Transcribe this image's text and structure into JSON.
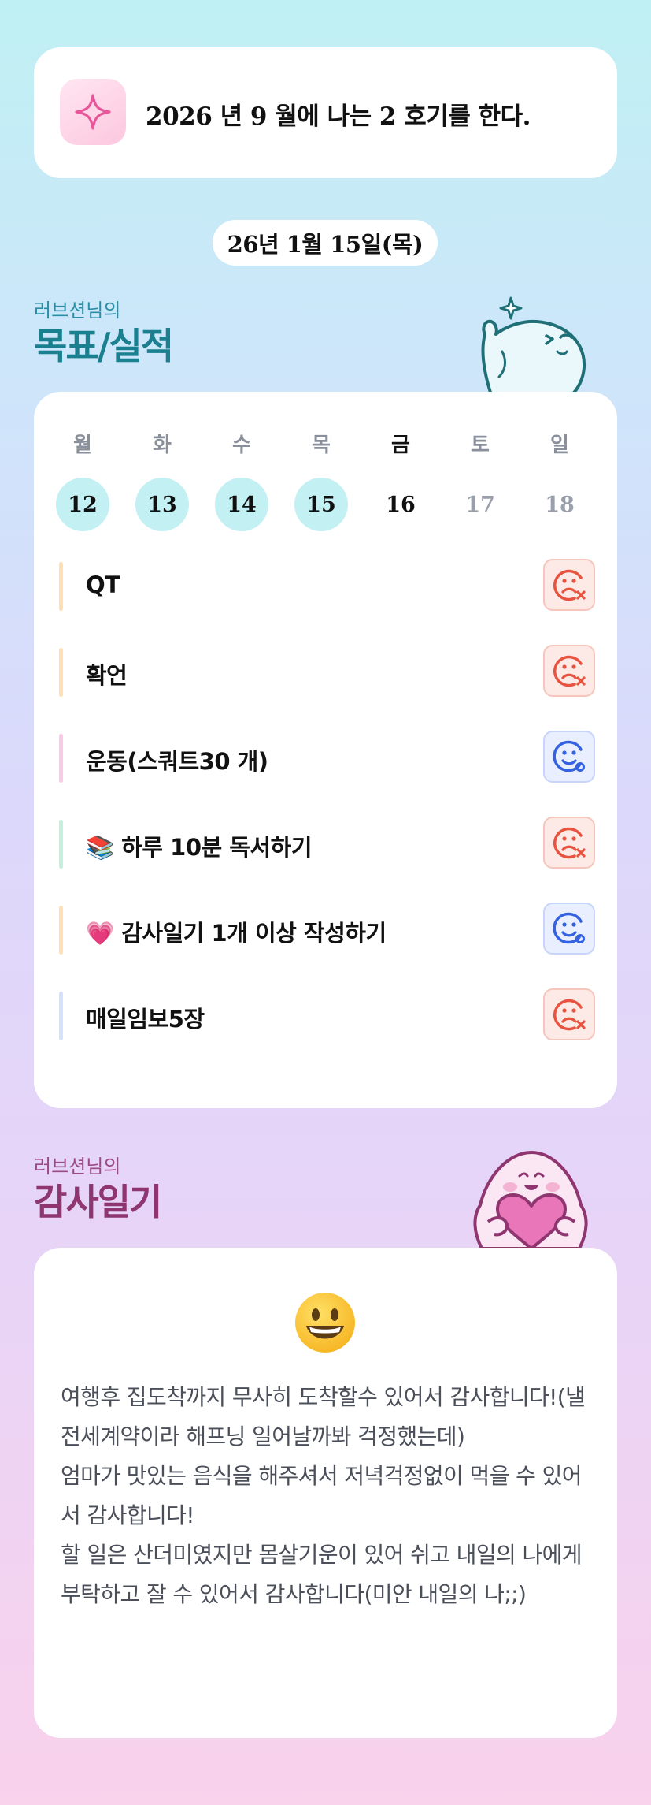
{
  "header": {
    "goal_statement": "2026 년 9 월에 나는 2 호기를 한다."
  },
  "date_label": "26년 1월 15일(목)",
  "goals_section": {
    "subtitle": "러브션님의",
    "title": "목표/실적"
  },
  "week": {
    "days": [
      {
        "weekday": "월",
        "date": "12",
        "state": "done"
      },
      {
        "weekday": "화",
        "date": "13",
        "state": "done"
      },
      {
        "weekday": "수",
        "date": "14",
        "state": "done"
      },
      {
        "weekday": "목",
        "date": "15",
        "state": "done"
      },
      {
        "weekday": "금",
        "date": "16",
        "state": "today"
      },
      {
        "weekday": "토",
        "date": "17",
        "state": "future"
      },
      {
        "weekday": "일",
        "date": "18",
        "state": "future"
      }
    ]
  },
  "goals": [
    {
      "label": "QT",
      "status": "fail",
      "bar_color": "#fde0b4"
    },
    {
      "label": "확언",
      "status": "fail",
      "bar_color": "#fde0b4"
    },
    {
      "label": "운동(스쿼트30 개)",
      "status": "success",
      "bar_color": "#f9cbe4"
    },
    {
      "label": "📚 하루 10분 독서하기",
      "status": "fail",
      "bar_color": "#c4f0de"
    },
    {
      "label": "💗 감사일기 1개 이상 작성하기",
      "status": "success",
      "bar_color": "#fde0b4"
    },
    {
      "label": "매일임보5장",
      "status": "fail",
      "bar_color": "#d6e2fb"
    }
  ],
  "gratitude_section": {
    "subtitle": "러브션님의",
    "title": "감사일기"
  },
  "gratitude": {
    "mood_icon": "grinning-face-icon",
    "text": "여행후 집도착까지 무사히 도착할수 있어서 감사합니다!(낼 전세계약이라 해프닝 일어날까봐 걱정했는데)\n엄마가 맛있는 음식을 해주셔서 저녁걱정없이 먹을 수 있어서 감사합니다!\n할 일은 산더미였지만 몸살기운이 있어 쉬고 내일의 나에게 부탁하고 잘 수 있어서 감사합니다(미안 내일의 나;;)"
  },
  "colors": {
    "fail": "#e8533f",
    "success": "#3462e0",
    "accent_teal": "#1a7f8e",
    "accent_plum": "#8f3570"
  }
}
